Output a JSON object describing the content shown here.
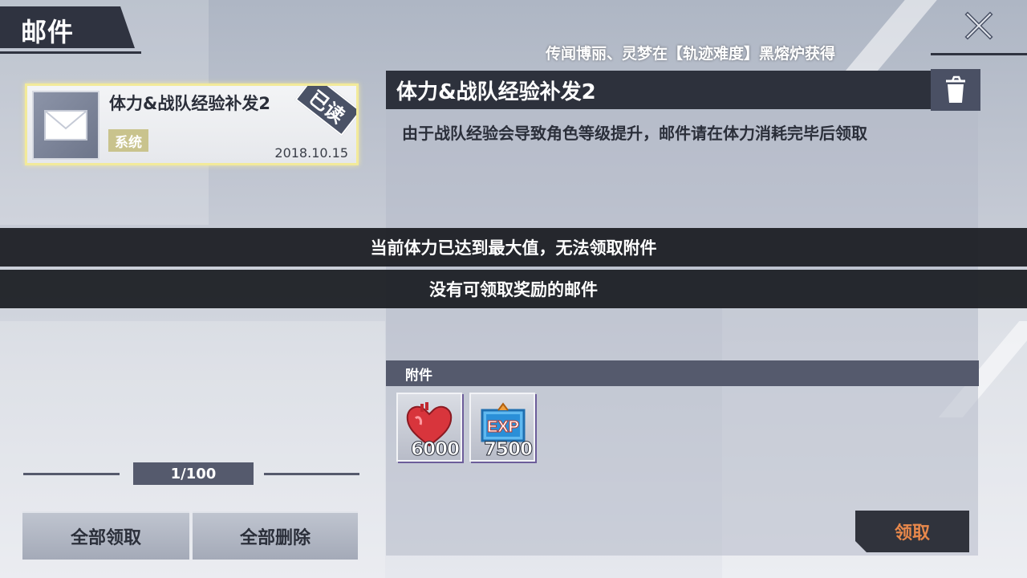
{
  "header": {
    "title": "邮件",
    "marquee": "传闻博丽、灵梦在【轨迹难度】黑熔炉获得"
  },
  "mail_list": [
    {
      "title": "体力&战队经验补发2",
      "tag": "系统",
      "date": "2018.10.15",
      "read_stamp": "已读",
      "selected": true
    }
  ],
  "detail": {
    "title": "体力&战队经验补发2",
    "body": "由于战队经验会导致角色等级提升，邮件请在体力消耗完毕后领取"
  },
  "toasts": [
    "当前体力已达到最大值，无法领取附件",
    "没有可领取奖励的邮件"
  ],
  "attachments": {
    "label": "附件",
    "items": [
      {
        "icon": "heart-stamina-icon",
        "count": "6000"
      },
      {
        "icon": "exp-icon",
        "count": "7500"
      }
    ]
  },
  "pagination": {
    "text": "1/100"
  },
  "buttons": {
    "claim_all": "全部领取",
    "delete_all": "全部删除",
    "claim": "领取"
  },
  "colors": {
    "panel_dark": "#2d313c",
    "selected_border": "#f2ea9a",
    "claim_text": "#e8884b",
    "tag_bg": "#c9c38d"
  }
}
